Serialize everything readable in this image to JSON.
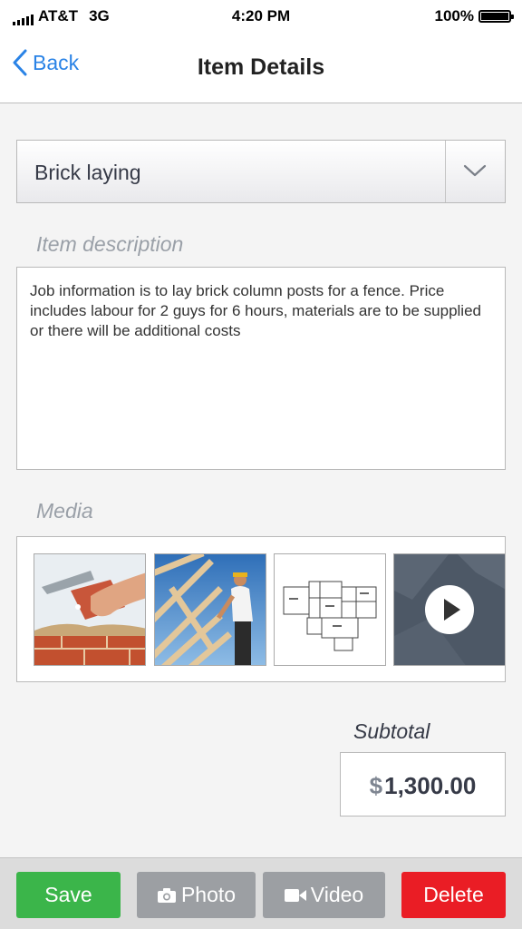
{
  "status": {
    "carrier": "AT&T",
    "network": "3G",
    "time": "4:20 PM",
    "battery": "100%",
    "battery_level": 1.0,
    "signal_bars": 5
  },
  "nav": {
    "back_label": "Back",
    "title": "Item Details"
  },
  "item": {
    "type": "Brick laying"
  },
  "description": {
    "label": "Item description",
    "text": "Job information is to lay brick column posts for a fence. Price includes labour for 2 guys for 6 hours, materials are to be supplied or there will be additional costs"
  },
  "media": {
    "label": "Media",
    "items": [
      {
        "kind": "photo",
        "subject": "bricklayer-hand-trowel"
      },
      {
        "kind": "photo",
        "subject": "worker-on-roof-trusses"
      },
      {
        "kind": "photo",
        "subject": "floor-plan-drawing"
      },
      {
        "kind": "video",
        "subject": "construction-video"
      }
    ]
  },
  "subtotal": {
    "label": "Subtotal",
    "currency": "$",
    "amount": "1,300.00"
  },
  "toolbar": {
    "save_label": "Save",
    "photo_label": "Photo",
    "video_label": "Video",
    "delete_label": "Delete"
  },
  "colors": {
    "accent": "#2a83e6",
    "save": "#3bb54a",
    "neutral": "#9c9fa3",
    "delete": "#ea1d25"
  }
}
